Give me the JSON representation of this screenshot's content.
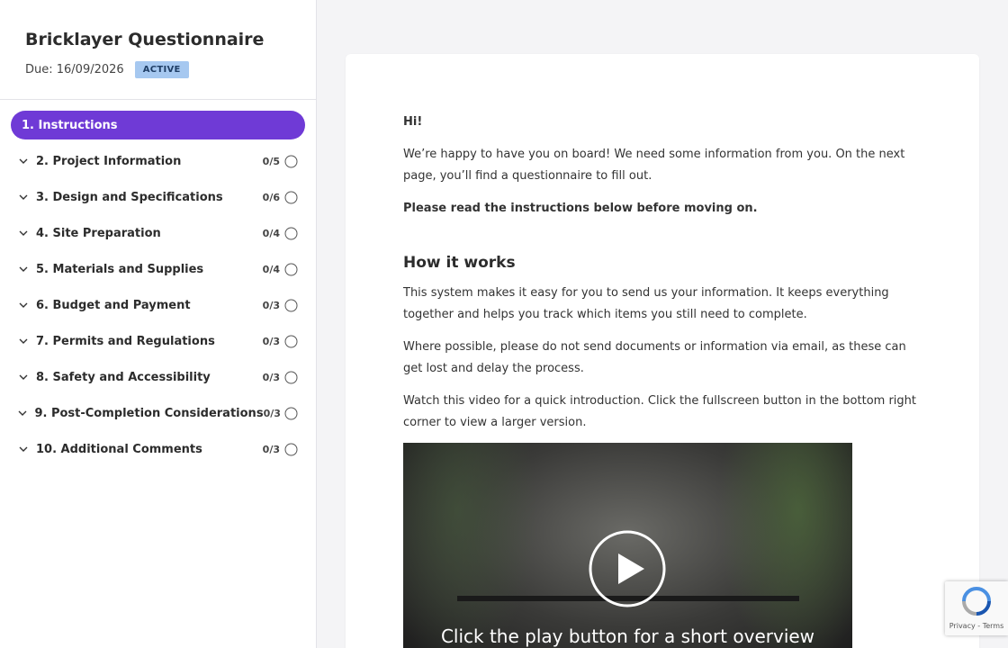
{
  "sidebar": {
    "title": "Bricklayer Questionnaire",
    "due": "Due: 16/09/2026",
    "status_badge": "ACTIVE",
    "items": [
      {
        "label": "1. Instructions",
        "count": ""
      },
      {
        "label": "2. Project Information",
        "count": "0/5"
      },
      {
        "label": "3. Design and Specifications",
        "count": "0/6"
      },
      {
        "label": "4. Site Preparation",
        "count": "0/4"
      },
      {
        "label": "5. Materials and Supplies",
        "count": "0/4"
      },
      {
        "label": "6. Budget and Payment",
        "count": "0/3"
      },
      {
        "label": "7. Permits and Regulations",
        "count": "0/3"
      },
      {
        "label": "8. Safety and Accessibility",
        "count": "0/3"
      },
      {
        "label": "9. Post-Completion Considerations",
        "count": "0/3"
      },
      {
        "label": "10. Additional Comments",
        "count": "0/3"
      }
    ]
  },
  "content": {
    "greeting": "Hi!",
    "intro": "We’re happy to have you on board! We need some information from you. On the next page, you’ll find a questionnaire to fill out.",
    "read_instructions": "Please read the instructions below before moving on.",
    "heading": "How it works",
    "para1": "This system makes it easy for you to send us your information. It keeps everything together and helps you track which items you still need to complete.",
    "para2": "Where possible, please do not send documents or information via email, as these can get lost and delay the process.",
    "para3": "Watch this video for a quick introduction. Click the fullscreen button in the bottom right corner to view a larger version.",
    "video_caption": "Click the play button for a short overview"
  },
  "recaptcha": {
    "links": "Privacy - Terms"
  },
  "colors": {
    "accent": "#6f3ad6",
    "badge_bg": "#a6c8f0",
    "background": "#f4f4f6"
  },
  "icons": {
    "chevron": "chevron-down-icon",
    "progress": "progress-ring-icon",
    "play": "play-icon",
    "recaptcha": "recaptcha-icon"
  }
}
